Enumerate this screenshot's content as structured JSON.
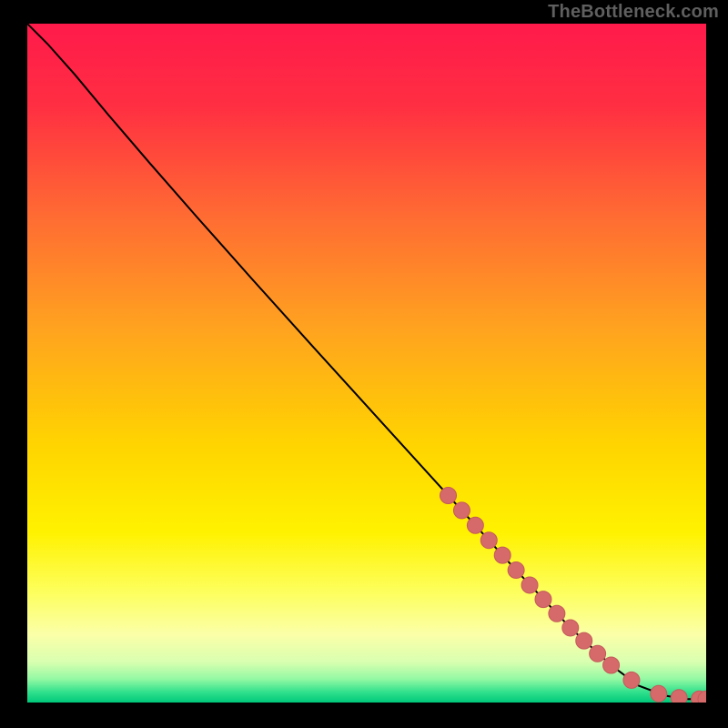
{
  "watermark": "TheBottleneck.com",
  "colors": {
    "background": "#000000",
    "gradient_stops": [
      {
        "offset": 0.0,
        "color": "#ff1a4b"
      },
      {
        "offset": 0.12,
        "color": "#ff2e42"
      },
      {
        "offset": 0.28,
        "color": "#ff6a33"
      },
      {
        "offset": 0.45,
        "color": "#ffa31f"
      },
      {
        "offset": 0.62,
        "color": "#ffd400"
      },
      {
        "offset": 0.75,
        "color": "#fff200"
      },
      {
        "offset": 0.84,
        "color": "#fdff60"
      },
      {
        "offset": 0.9,
        "color": "#fbffa8"
      },
      {
        "offset": 0.94,
        "color": "#d9ffb0"
      },
      {
        "offset": 0.965,
        "color": "#95f9a4"
      },
      {
        "offset": 0.985,
        "color": "#2fe08c"
      },
      {
        "offset": 1.0,
        "color": "#00c97a"
      }
    ],
    "curve": "#000000",
    "marker_fill": "#d66a6a",
    "marker_stroke": "#c45a5a"
  },
  "chart_data": {
    "type": "line",
    "title": "",
    "xlabel": "",
    "ylabel": "",
    "xlim": [
      0,
      100
    ],
    "ylim": [
      0,
      100
    ],
    "series": [
      {
        "name": "curve",
        "x": [
          0,
          3,
          7,
          12,
          18,
          25,
          33,
          42,
          52,
          62,
          72,
          80,
          86,
          90,
          94,
          97,
          100
        ],
        "y": [
          100,
          97,
          92.5,
          86.5,
          79.5,
          71.5,
          62.5,
          52.5,
          41.5,
          30.5,
          19.5,
          11,
          5.5,
          2.5,
          1,
          0.5,
          0.5
        ]
      }
    ],
    "markers": {
      "name": "highlighted-points",
      "x": [
        62,
        64,
        66,
        68,
        70,
        72,
        74,
        76,
        78,
        80,
        82,
        84,
        86,
        89,
        93,
        96,
        99,
        100
      ],
      "y": [
        30.5,
        28.3,
        26.1,
        23.9,
        21.7,
        19.5,
        17.3,
        15.2,
        13.1,
        11,
        9.1,
        7.2,
        5.5,
        3.3,
        1.3,
        0.7,
        0.5,
        0.5
      ]
    }
  }
}
